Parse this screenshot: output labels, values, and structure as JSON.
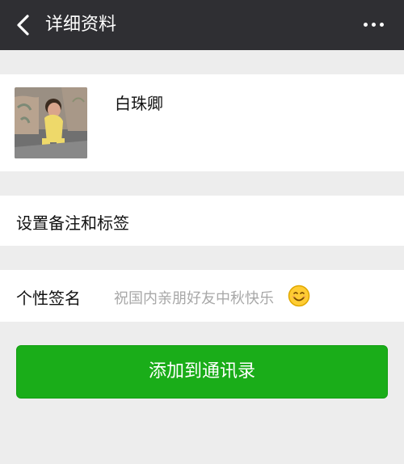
{
  "header": {
    "title": "详细资料",
    "back_icon": "chevron-left-icon",
    "more_icon": "more-horizontal-icon"
  },
  "profile": {
    "nickname": "白珠卿",
    "avatar_icon": "avatar-photo"
  },
  "remark": {
    "label": "设置备注和标签"
  },
  "signature": {
    "label": "个性签名",
    "value": "祝国内亲朋好友中秋快乐",
    "emoji_icon": "smile-emoji-icon"
  },
  "actions": {
    "add_contact_label": "添加到通讯录"
  },
  "colors": {
    "topbar": "#2f2f33",
    "background": "#ededed",
    "primary_green": "#1aad19",
    "muted_text": "#a8a8a8"
  }
}
